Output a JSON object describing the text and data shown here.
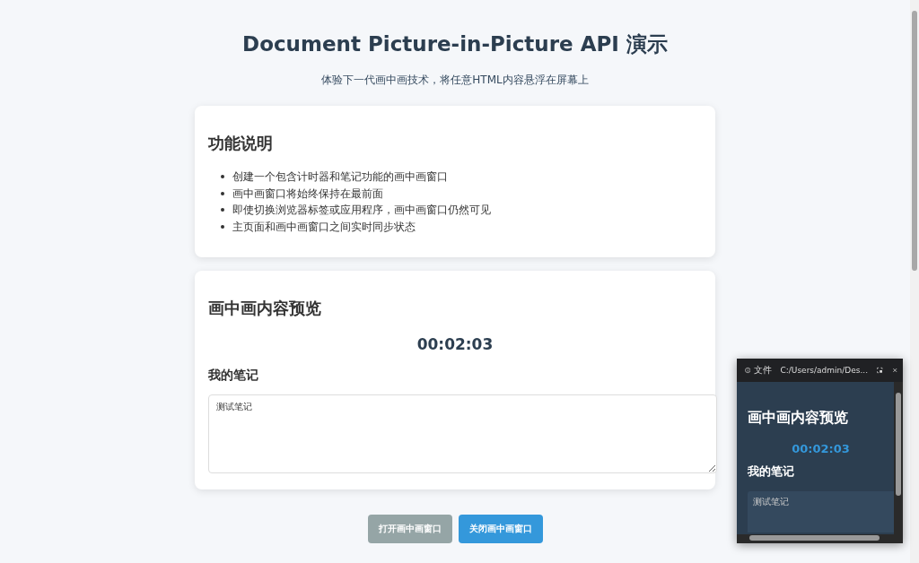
{
  "page": {
    "title": "Document Picture-in-Picture API 演示",
    "subtitle": "体验下一代画中画技术，将任意HTML内容悬浮在屏幕上"
  },
  "features": {
    "heading": "功能说明",
    "items": [
      "创建一个包含计时器和笔记功能的画中画窗口",
      "画中画窗口将始终保持在最前面",
      "即使切换浏览器标签或应用程序，画中画窗口仍然可见",
      "主页面和画中画窗口之间实时同步状态"
    ]
  },
  "preview": {
    "heading": "画中画内容预览",
    "timer": "00:02:03",
    "notes_label": "我的笔记",
    "notes_value": "测试笔记"
  },
  "buttons": [
    {
      "label": "打开画中画窗口",
      "disabled": true
    },
    {
      "label": "关闭画中画窗口",
      "disabled": false
    }
  ],
  "pip_window": {
    "origin": "文件",
    "url": "C:/Users/admin/Des...",
    "heading": "画中画内容预览",
    "timer": "00:02:03",
    "notes_label": "我的笔记",
    "notes_value": "测试笔记"
  }
}
